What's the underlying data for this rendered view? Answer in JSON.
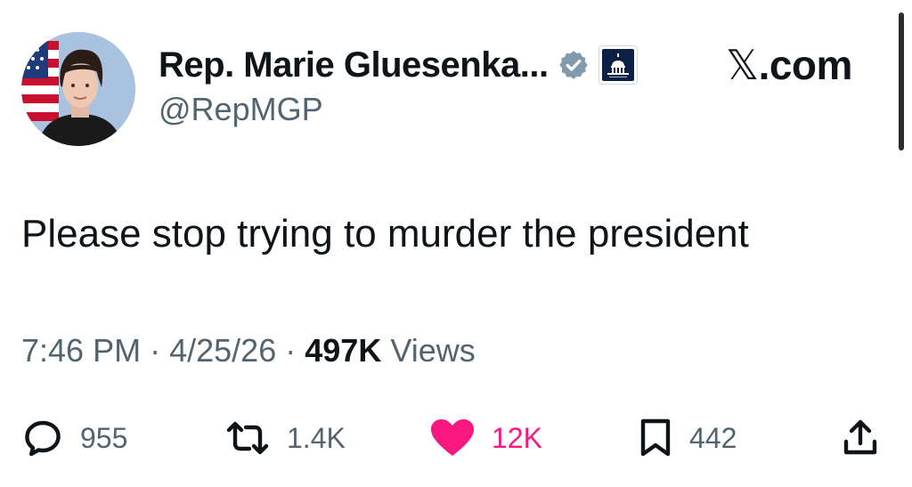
{
  "user": {
    "display_name": "Rep. Marie Gluesenka...",
    "handle": "@RepMGP"
  },
  "site_label_mark": "𝕏",
  "site_label_suffix": ".com",
  "tweet": {
    "text": "Please stop trying to murder the president",
    "time": "7:46 PM",
    "date": "4/25/26",
    "separator": "·",
    "views_count": "497K",
    "views_label": "Views"
  },
  "actions": {
    "replies": "955",
    "reposts": "1.4K",
    "likes": "12K",
    "bookmarks": "442"
  },
  "icons": {
    "verified": "verified-badge-icon",
    "government": "capitol-building-icon",
    "reply": "reply-bubble-icon",
    "repost": "repost-arrows-icon",
    "like": "heart-icon",
    "bookmark": "bookmark-icon",
    "share": "share-upload-icon"
  },
  "colors": {
    "text_primary": "#0f1419",
    "text_secondary": "#536471",
    "like_active": "#f91880",
    "verified_gray": "#829aab"
  }
}
